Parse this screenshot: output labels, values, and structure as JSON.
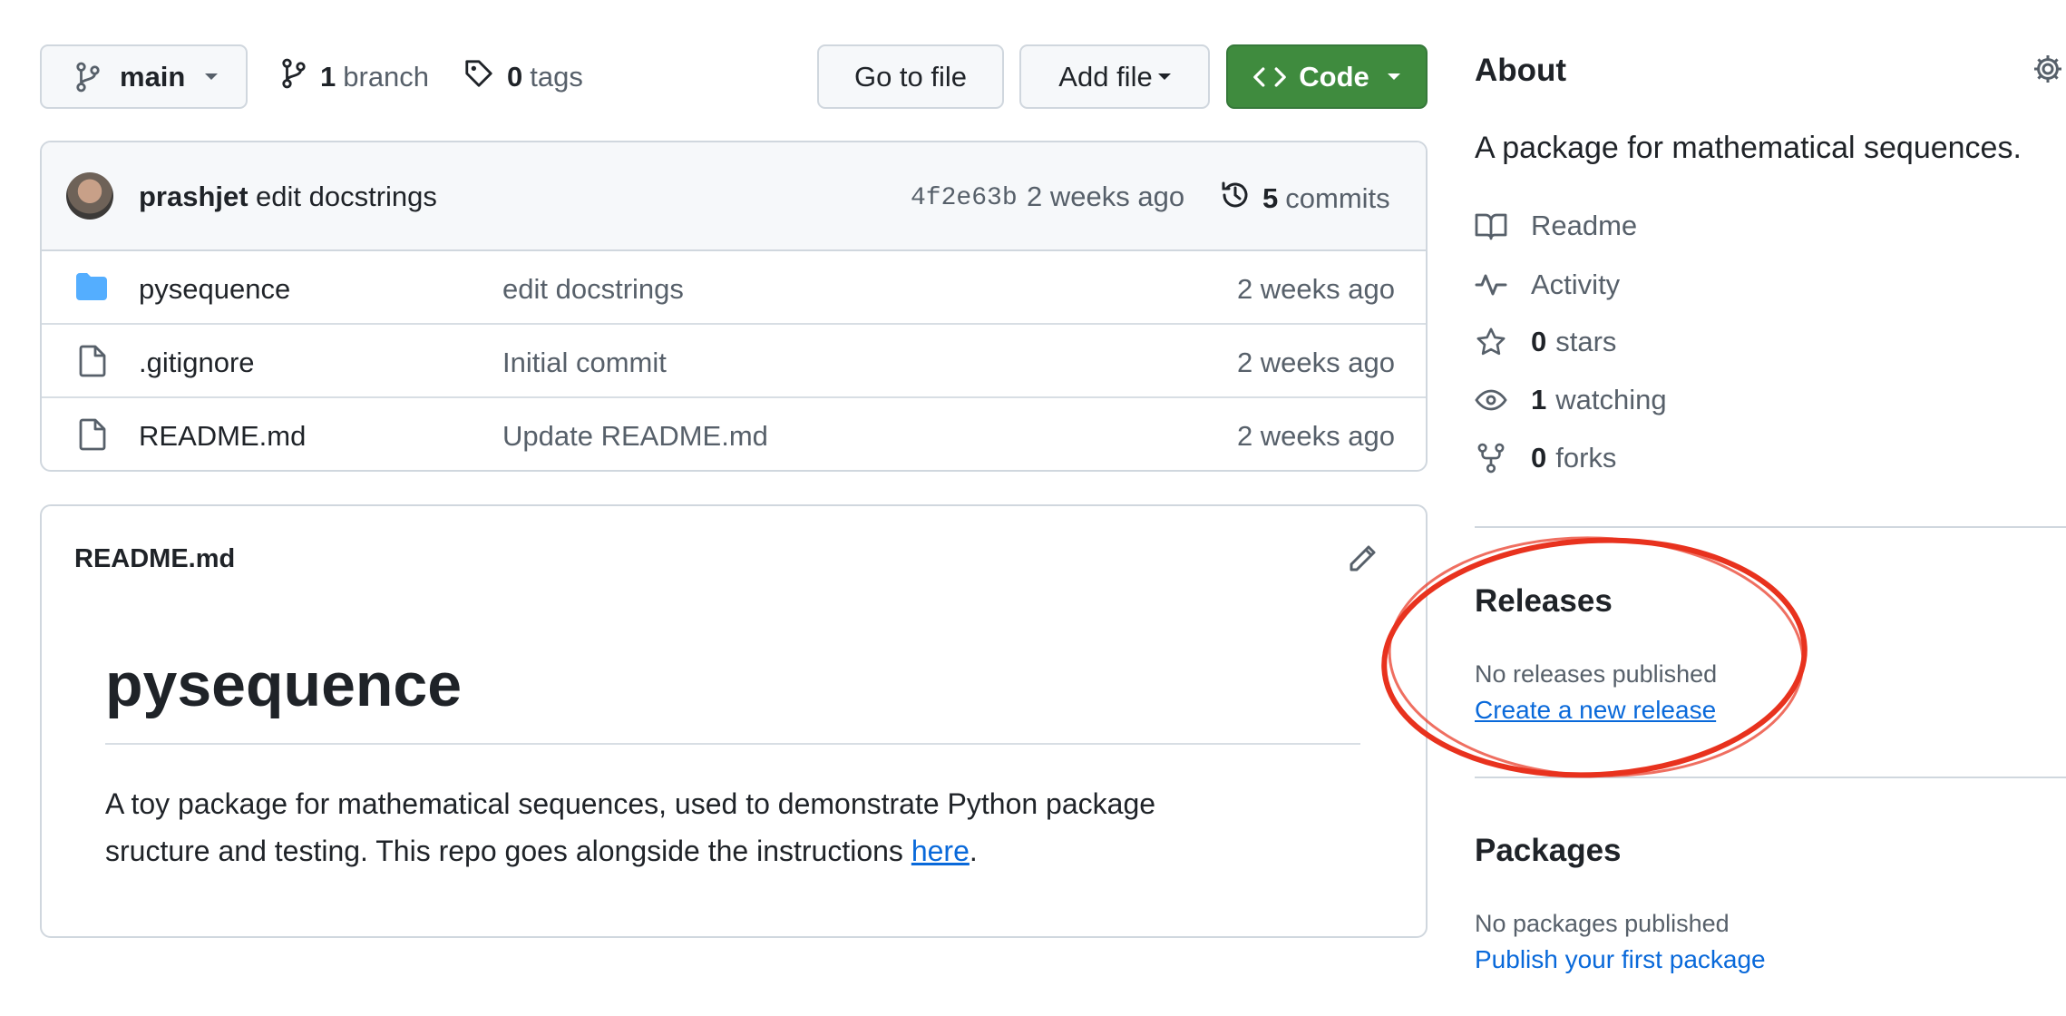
{
  "toolbar": {
    "branch_name": "main",
    "branch_count": "1",
    "branch_label": "branch",
    "tag_count": "0",
    "tag_label": "tags",
    "go_to_file": "Go to file",
    "add_file": "Add file",
    "code": "Code"
  },
  "commit": {
    "author": "prashjet",
    "message": "edit docstrings",
    "sha": "4f2e63b",
    "time": "2 weeks ago",
    "commits_count": "5",
    "commits_label": "commits"
  },
  "files": [
    {
      "name": "pysequence",
      "type": "folder",
      "message": "edit docstrings",
      "time": "2 weeks ago"
    },
    {
      "name": ".gitignore",
      "type": "file",
      "message": "Initial commit",
      "time": "2 weeks ago"
    },
    {
      "name": "README.md",
      "type": "file",
      "message": "Update README.md",
      "time": "2 weeks ago"
    }
  ],
  "readme": {
    "filename": "README.md",
    "heading": "pysequence",
    "body_line1": "A toy package for mathematical sequences, used to demonstrate Python package",
    "body_line2_prefix": "sructure and testing. This repo goes alongside the instructions ",
    "body_link": "here",
    "body_suffix": "."
  },
  "about": {
    "title": "About",
    "description": "A package for mathematical sequences.",
    "readme": "Readme",
    "activity": "Activity",
    "stars_count": "0",
    "stars_label": "stars",
    "watching_count": "1",
    "watching_label": "watching",
    "forks_count": "0",
    "forks_label": "forks"
  },
  "releases": {
    "title": "Releases",
    "status": "No releases published",
    "create_link": "Create a new release"
  },
  "packages": {
    "title": "Packages",
    "status": "No packages published",
    "publish_link": "Publish your first package"
  },
  "colors": {
    "code_button": "#3f8b3e",
    "link": "#0969da",
    "annotation": "#e8321e",
    "folder": "#54aeff"
  }
}
